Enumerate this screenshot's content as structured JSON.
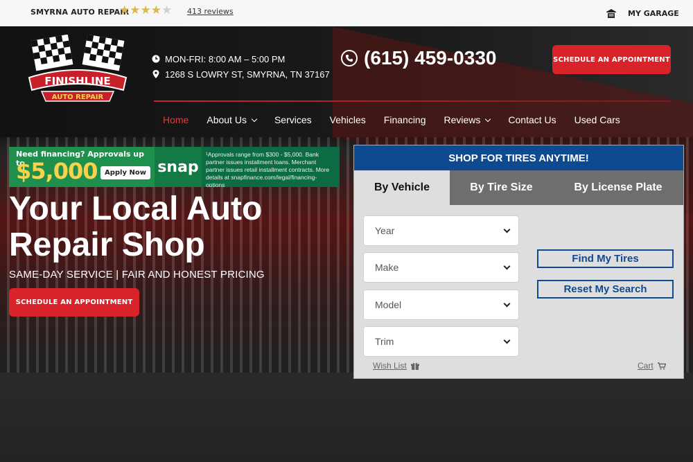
{
  "topbar": {
    "shop_name": "SMYRNA AUTO REPAIR",
    "rating_stars": 4.5,
    "reviews_link": "413 reviews",
    "garage_label": "MY GARAGE",
    "garage_icon": "garage-icon"
  },
  "header": {
    "logo": {
      "line1": "FINISHLINE",
      "line2": "AUTO REPAIR"
    },
    "hours": "MON-FRI: 8:00 AM – 5:00 PM",
    "address": "1268 S LOWRY ST, SMYRNA, TN 37167",
    "phone": "(615) 459-0330",
    "schedule_label": "SCHEDULE AN APPOINTMENT"
  },
  "nav": {
    "items": [
      {
        "label": "Home"
      },
      {
        "label": "About Us"
      },
      {
        "label": "Services"
      },
      {
        "label": "Vehicles"
      },
      {
        "label": "Financing"
      },
      {
        "label": "Reviews"
      },
      {
        "label": "Contact Us"
      },
      {
        "label": "Used Cars"
      }
    ]
  },
  "snap_banner": {
    "question": "Need financing? Approvals up to",
    "amount": "$5,000",
    "apply": "Apply Now",
    "brand": "snap",
    "fine_print": "¹Approvals range from $300 - $5,000. Bank partner issues installment loans. Merchant partner issues retail installment contracts. More details at snapfinance.com/legal/financing-options"
  },
  "hero": {
    "title_line1": "Your Local Auto",
    "title_line2": "Repair Shop",
    "tagline": "SAME-DAY SERVICE | FAIR AND HONEST PRICING",
    "schedule_label": "SCHEDULE AN APPOINTMENT"
  },
  "tire_panel": {
    "heading": "SHOP FOR TIRES ANYTIME!",
    "tabs": [
      {
        "label": "By Vehicle"
      },
      {
        "label": "By Tire Size"
      },
      {
        "label": "By License Plate"
      }
    ],
    "selects": [
      {
        "placeholder": "Year"
      },
      {
        "placeholder": "Make"
      },
      {
        "placeholder": "Model"
      },
      {
        "placeholder": "Trim"
      }
    ],
    "find_label": "Find My Tires",
    "reset_label": "Reset My Search",
    "wishlist_label": "Wish List",
    "cart_label": "Cart"
  },
  "colors": {
    "accent_red": "#d8232a",
    "accent_blue": "#0e4a8f"
  }
}
